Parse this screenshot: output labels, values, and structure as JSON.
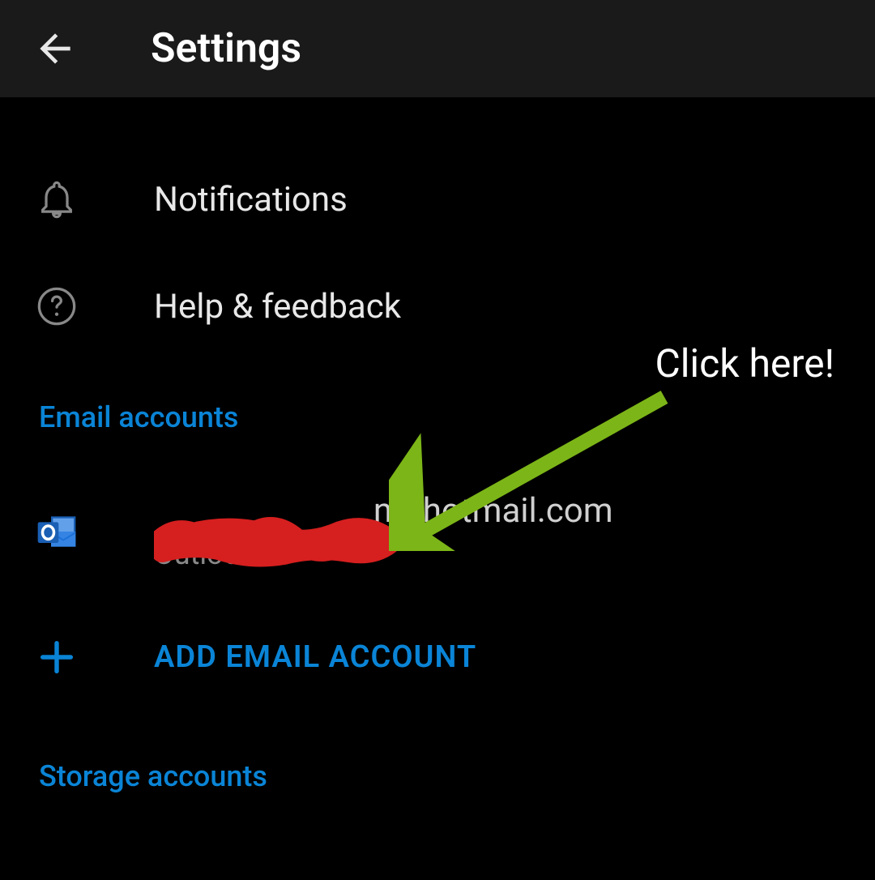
{
  "header": {
    "title": "Settings"
  },
  "items": {
    "notifications": "Notifications",
    "help": "Help & feedback"
  },
  "sections": {
    "email_accounts": "Email accounts",
    "storage_accounts": "Storage accounts"
  },
  "account": {
    "email_visible_suffix": "n@hotmail.com",
    "provider": "Outlook"
  },
  "add_account": {
    "label": "ADD EMAIL ACCOUNT"
  },
  "annotation": {
    "text": "Click here!"
  },
  "colors": {
    "accent": "#0a84d6",
    "arrow": "#7cb518",
    "redaction": "#d61f1f"
  }
}
